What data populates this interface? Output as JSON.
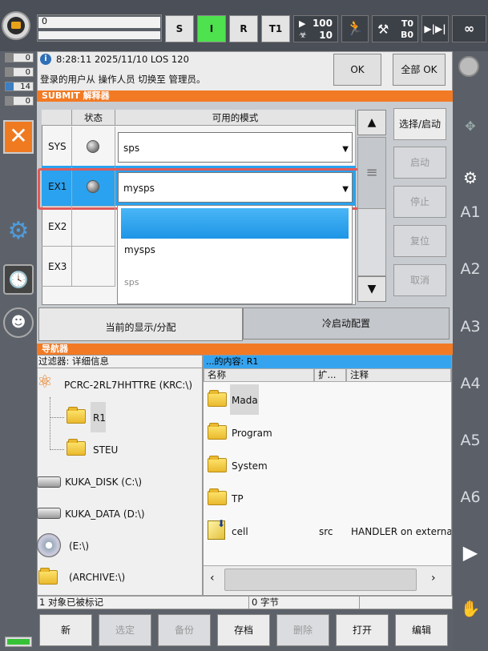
{
  "topbar": {
    "program_value": "0",
    "btn_s": "S",
    "btn_i": "I",
    "btn_r": "R",
    "btn_t1": "T1",
    "override_top": "100",
    "override_bottom": "10",
    "tool_t": "T0",
    "tool_b": "B0",
    "incremental": "▶|▶|",
    "infinity": "∞",
    "colors": {
      "active_mode": "#4ee24e",
      "accent": "#f27a24"
    }
  },
  "left_counters": [
    "0",
    "0",
    "14",
    "0"
  ],
  "message": {
    "time_line": "8:28:11 2025/11/10 LOS 120",
    "text": "登录的用户从 操作人员 切换至 管理员。",
    "ok": "OK",
    "all_ok": "全部 OK"
  },
  "submit": {
    "title": "SUBMIT 解释器",
    "col_status": "状态",
    "col_modes": "可用的模式",
    "rows": [
      {
        "name": "SYS",
        "mode": "sps"
      },
      {
        "name": "EX1",
        "mode": "mysps"
      },
      {
        "name": "EX2",
        "mode": ""
      },
      {
        "name": "EX3",
        "mode": ""
      }
    ],
    "dropdown_options": [
      "",
      "mysps",
      "sps"
    ],
    "buttons": {
      "select_start": "选择/启动",
      "start": "启动",
      "stop": "停止",
      "reset": "复位",
      "cancel": "取消"
    },
    "tab_display": "当前的显示/分配",
    "tab_cold": "冷启动配置"
  },
  "navigator": {
    "title": "导航器",
    "filter": "过滤器: 详细信息",
    "tree": {
      "root": "PCRC-2RL7HHTTRE (KRC:\\)",
      "r1": "R1",
      "steu": "STEU",
      "kuka_disk": "KUKA_DISK (C:\\)",
      "kuka_data": "KUKA_DATA (D:\\)",
      "e_drive": "(E:\\)",
      "archive": "(ARCHIVE:\\)"
    },
    "content_head": "...的内容: R1",
    "col_name": "名称",
    "col_ext": "扩...",
    "col_comment": "注释",
    "files": [
      {
        "name": "Mada",
        "ext": "",
        "comment": ""
      },
      {
        "name": "Program",
        "ext": "",
        "comment": ""
      },
      {
        "name": "System",
        "ext": "",
        "comment": ""
      },
      {
        "name": "TP",
        "ext": "",
        "comment": ""
      },
      {
        "name": "cell",
        "ext": "src",
        "comment": "HANDLER on external ..."
      }
    ]
  },
  "status": {
    "marked": "1 对象已被标记",
    "bytes": "0 字节"
  },
  "bottom": {
    "new": "新",
    "select": "选定",
    "backup": "备份",
    "archive": "存档",
    "delete": "删除",
    "open": "打开",
    "edit": "编辑"
  },
  "right_axes": [
    "A1",
    "A2",
    "A3",
    "A4",
    "A5",
    "A6"
  ],
  "icons": {
    "logo": "kuka-robot-logo-icon",
    "play": "play-icon",
    "hand": "jog-hand-icon",
    "walk": "walking-person-icon",
    "gear": "gear-icon",
    "clock": "clock-icon",
    "users": "user-group-icon"
  }
}
